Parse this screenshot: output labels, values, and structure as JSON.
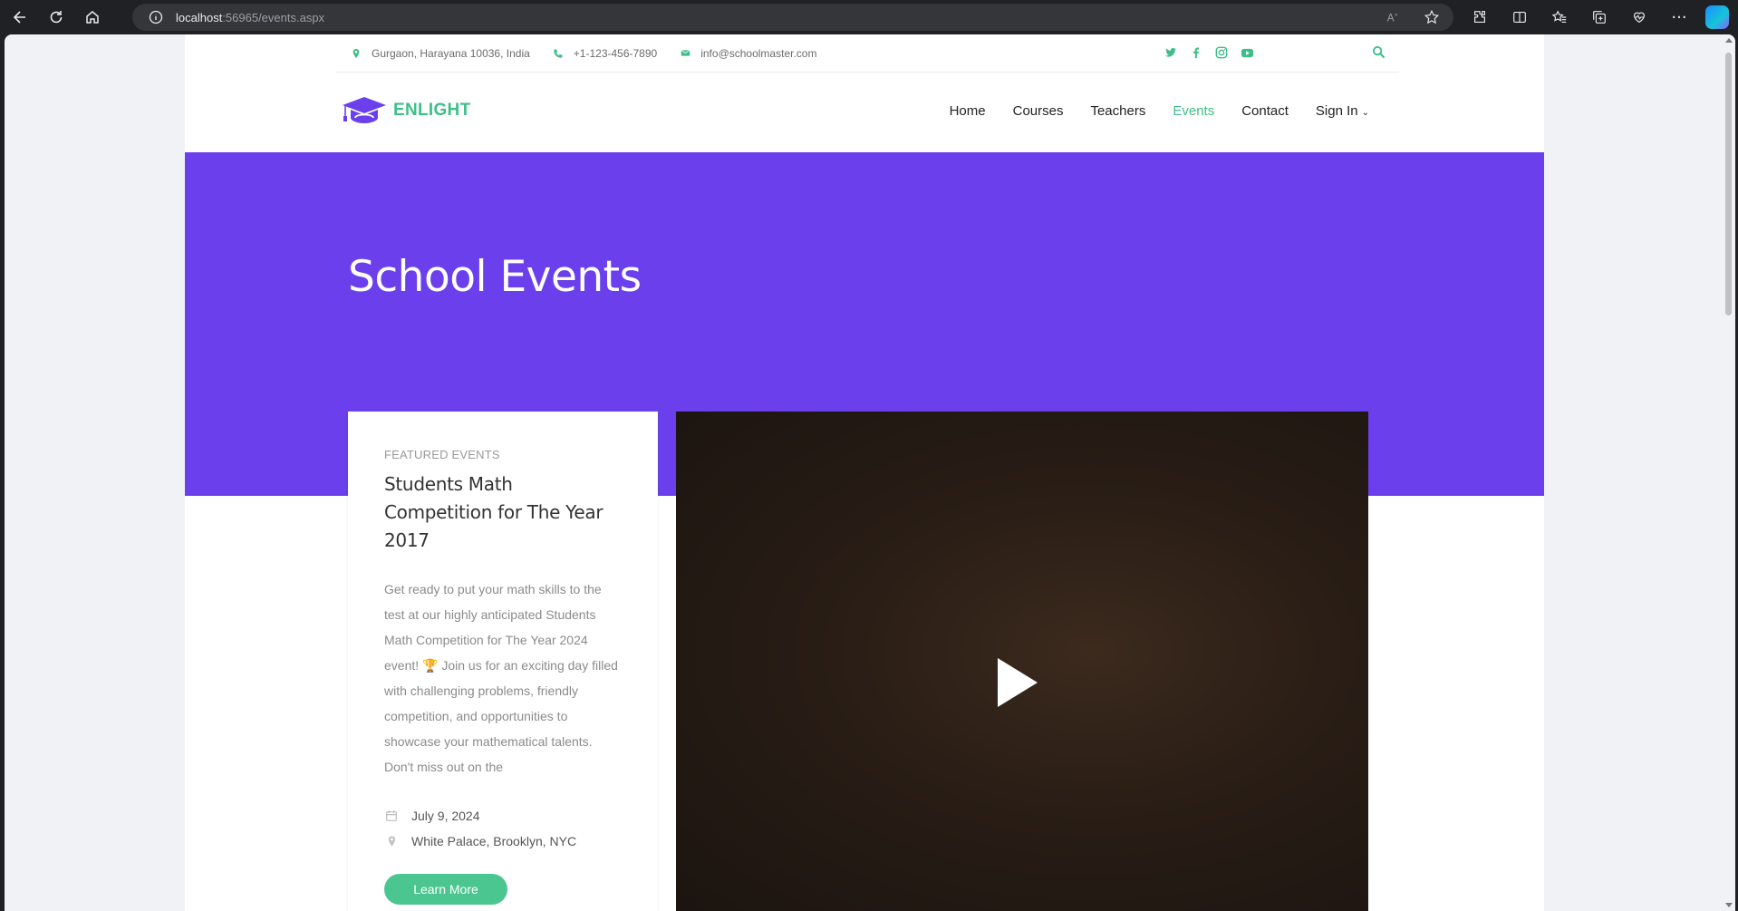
{
  "browser": {
    "url_host": "localhost",
    "url_path": ":56965/events.aspx"
  },
  "topbar": {
    "address": "Gurgaon, Harayana 10036, India",
    "phone": "+1-123-456-7890",
    "email": "info@schoolmaster.com",
    "socials": [
      "twitter-icon",
      "facebook-icon",
      "instagram-icon",
      "youtube-icon"
    ]
  },
  "header": {
    "brand": "ENLIGHT",
    "nav": [
      {
        "label": "Home",
        "active": false
      },
      {
        "label": "Courses",
        "active": false
      },
      {
        "label": "Teachers",
        "active": false
      },
      {
        "label": "Events",
        "active": true
      },
      {
        "label": "Contact",
        "active": false
      },
      {
        "label": "Sign In",
        "active": false
      }
    ]
  },
  "hero": {
    "title": "School Events"
  },
  "event": {
    "kicker": "FEATURED EVENTS",
    "title": "Students Math Competition for The Year 2017",
    "description": "Get ready to put your math skills to the test at our highly anticipated Students Math Competition for The Year 2024 event! 🏆 Join us for an exciting day filled with challenging problems, friendly competition, and opportunities to showcase your mathematical talents. Don't miss out on the",
    "date": "July 9, 2024",
    "location": "White Palace, Brooklyn, NYC",
    "button": "Learn More"
  },
  "colors": {
    "accent": "#3ebf8a",
    "hero": "#6b40ec",
    "button": "#4cc690"
  }
}
